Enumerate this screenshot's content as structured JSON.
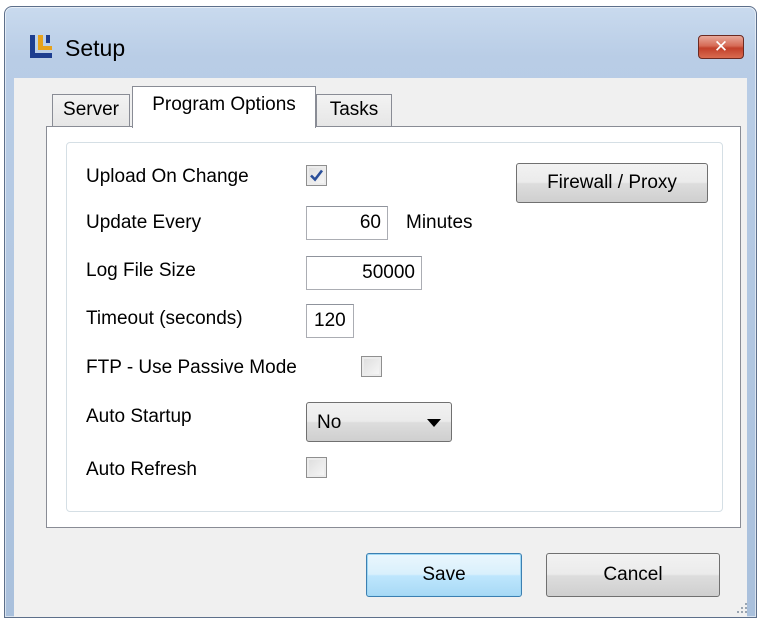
{
  "window": {
    "title": "Setup",
    "close_label": "✕"
  },
  "tabs": [
    {
      "label": "Server"
    },
    {
      "label": "Program Options"
    },
    {
      "label": "Tasks"
    }
  ],
  "options": {
    "upload_on_change": {
      "label": "Upload On Change",
      "checked": true
    },
    "update_every": {
      "label": "Update Every",
      "value": "60",
      "unit": "Minutes"
    },
    "log_file_size": {
      "label": "Log File Size",
      "value": "50000"
    },
    "timeout": {
      "label": "Timeout (seconds)",
      "value": "120"
    },
    "ftp_passive": {
      "label": "FTP - Use Passive Mode",
      "checked": false
    },
    "auto_startup": {
      "label": "Auto Startup",
      "value": "No"
    },
    "auto_refresh": {
      "label": "Auto Refresh",
      "checked": false
    },
    "firewall_button": "Firewall / Proxy"
  },
  "footer": {
    "save_label": "Save",
    "cancel_label": "Cancel"
  },
  "colors": {
    "title_gradient": "#b9cde6",
    "client_bg": "#f0f0f0",
    "close_red": "#c2402a",
    "default_button_border": "#3c7fb1"
  },
  "icons": {
    "app": "app-logo-icon",
    "close": "close-icon",
    "check": "checkmark-icon",
    "dropdown": "chevron-down-icon",
    "grip": "resize-grip-icon"
  }
}
